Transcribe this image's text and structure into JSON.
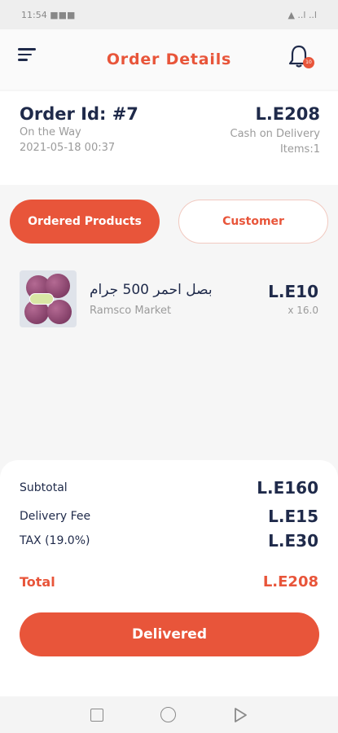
{
  "status_bar": {
    "left_text": "11:54 ■■■",
    "right_text": "▲ ..l ..l"
  },
  "header": {
    "title": "Order Details",
    "bell_badge": "10"
  },
  "order": {
    "id_label": "Order Id: #7",
    "status": "On the Way",
    "date": "2021-05-18 00:37",
    "total": "L.E208",
    "payment_method": "Cash on Delivery",
    "items": "Items:1"
  },
  "tabs": {
    "products": "Ordered Products",
    "customer": "Customer"
  },
  "products": [
    {
      "name": "بصل احمر 500 جرام",
      "store": "Ramsco Market",
      "price": "L.E10",
      "quantity": "x 16.0"
    }
  ],
  "summary": {
    "subtotal_label": "Subtotal",
    "subtotal_value": "L.E160",
    "delivery_label": "Delivery Fee",
    "delivery_value": "L.E15",
    "tax_label": "TAX (19.0%)",
    "tax_value": "L.E30",
    "total_label": "Total",
    "total_value": "L.E208"
  },
  "action": {
    "delivered_label": "Delivered"
  },
  "colors": {
    "accent": "#e8553a",
    "text_dark": "#1f2a4a",
    "text_muted": "#9b9b9b"
  },
  "icons": [
    "menu-icon",
    "bell-icon",
    "nav-back-icon",
    "nav-home-icon",
    "nav-recents-icon"
  ]
}
